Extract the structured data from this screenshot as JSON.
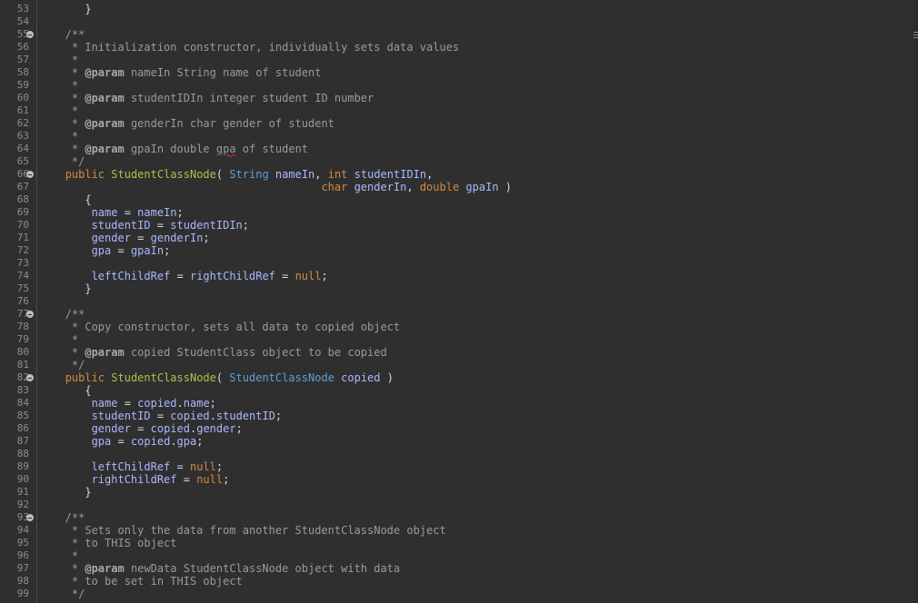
{
  "editor": {
    "language": "java",
    "colors": {
      "background": "#2f2f2f",
      "keyword": "#d38a3e",
      "type": "#5d9fd6",
      "method": "#a7c44a",
      "field": "#aab8ff",
      "comment": "#9a9a9a"
    },
    "fold_lines": [
      55,
      66,
      77,
      82,
      93
    ],
    "lines": [
      {
        "n": "53",
        "t": [
          [
            "p",
            "      }"
          ]
        ]
      },
      {
        "n": "54",
        "t": []
      },
      {
        "n": "55",
        "t": [
          [
            "c",
            "   /**"
          ]
        ]
      },
      {
        "n": "56",
        "t": [
          [
            "c",
            "    * Initialization constructor, individually sets data values"
          ]
        ]
      },
      {
        "n": "57",
        "t": [
          [
            "c",
            "    *"
          ]
        ]
      },
      {
        "n": "58",
        "t": [
          [
            "c",
            "    * "
          ],
          [
            "g",
            "@param"
          ],
          [
            "c",
            " nameIn String name of student"
          ]
        ]
      },
      {
        "n": "59",
        "t": [
          [
            "c",
            "    *"
          ]
        ]
      },
      {
        "n": "60",
        "t": [
          [
            "c",
            "    * "
          ],
          [
            "g",
            "@param"
          ],
          [
            "c",
            " studentIDIn integer student ID number"
          ]
        ]
      },
      {
        "n": "61",
        "t": [
          [
            "c",
            "    *"
          ]
        ]
      },
      {
        "n": "62",
        "t": [
          [
            "c",
            "    * "
          ],
          [
            "g",
            "@param"
          ],
          [
            "c",
            " genderIn char gender of student"
          ]
        ]
      },
      {
        "n": "63",
        "t": [
          [
            "c",
            "    *"
          ]
        ]
      },
      {
        "n": "64",
        "t": [
          [
            "c",
            "    * "
          ],
          [
            "g",
            "@param"
          ],
          [
            "c",
            " gpaIn double "
          ],
          [
            "s",
            "gpa"
          ],
          [
            "c",
            " of student"
          ]
        ]
      },
      {
        "n": "65",
        "t": [
          [
            "c",
            "    */"
          ]
        ]
      },
      {
        "n": "66",
        "t": [
          [
            "p",
            "   "
          ],
          [
            "k",
            "public"
          ],
          [
            "p",
            " "
          ],
          [
            "m",
            "StudentClassNode"
          ],
          [
            "p",
            "( "
          ],
          [
            "y",
            "String"
          ],
          [
            "p",
            " "
          ],
          [
            "v",
            "nameIn"
          ],
          [
            "p",
            ", "
          ],
          [
            "k",
            "int"
          ],
          [
            "p",
            " "
          ],
          [
            "v",
            "studentIDIn"
          ],
          [
            "p",
            ","
          ]
        ]
      },
      {
        "n": "67",
        "t": [
          [
            "p",
            "                                          "
          ],
          [
            "k",
            "char"
          ],
          [
            "p",
            " "
          ],
          [
            "v",
            "genderIn"
          ],
          [
            "p",
            ", "
          ],
          [
            "k",
            "double"
          ],
          [
            "p",
            " "
          ],
          [
            "v",
            "gpaIn"
          ],
          [
            "p",
            " )"
          ]
        ]
      },
      {
        "n": "68",
        "t": [
          [
            "p",
            "      {"
          ]
        ]
      },
      {
        "n": "69",
        "t": [
          [
            "p",
            "       "
          ],
          [
            "v",
            "name"
          ],
          [
            "p",
            " = "
          ],
          [
            "v",
            "nameIn"
          ],
          [
            "p",
            ";"
          ]
        ]
      },
      {
        "n": "70",
        "t": [
          [
            "p",
            "       "
          ],
          [
            "v",
            "studentID"
          ],
          [
            "p",
            " = "
          ],
          [
            "v",
            "studentIDIn"
          ],
          [
            "p",
            ";"
          ]
        ]
      },
      {
        "n": "71",
        "t": [
          [
            "p",
            "       "
          ],
          [
            "v",
            "gender"
          ],
          [
            "p",
            " = "
          ],
          [
            "v",
            "genderIn"
          ],
          [
            "p",
            ";"
          ]
        ]
      },
      {
        "n": "72",
        "t": [
          [
            "p",
            "       "
          ],
          [
            "v",
            "gpa"
          ],
          [
            "p",
            " = "
          ],
          [
            "v",
            "gpaIn"
          ],
          [
            "p",
            ";"
          ]
        ]
      },
      {
        "n": "73",
        "t": []
      },
      {
        "n": "74",
        "t": [
          [
            "p",
            "       "
          ],
          [
            "v",
            "leftChildRef"
          ],
          [
            "p",
            " = "
          ],
          [
            "v",
            "rightChildRef"
          ],
          [
            "p",
            " = "
          ],
          [
            "k",
            "null"
          ],
          [
            "p",
            ";"
          ]
        ]
      },
      {
        "n": "75",
        "t": [
          [
            "p",
            "      }"
          ]
        ]
      },
      {
        "n": "76",
        "t": []
      },
      {
        "n": "77",
        "t": [
          [
            "c",
            "   /**"
          ]
        ]
      },
      {
        "n": "78",
        "t": [
          [
            "c",
            "    * Copy constructor, sets all data to copied object"
          ]
        ]
      },
      {
        "n": "79",
        "t": [
          [
            "c",
            "    *"
          ]
        ]
      },
      {
        "n": "80",
        "t": [
          [
            "c",
            "    * "
          ],
          [
            "g",
            "@param"
          ],
          [
            "c",
            " copied StudentClass object to be copied"
          ]
        ]
      },
      {
        "n": "81",
        "t": [
          [
            "c",
            "    */"
          ]
        ]
      },
      {
        "n": "82",
        "t": [
          [
            "p",
            "   "
          ],
          [
            "k",
            "public"
          ],
          [
            "p",
            " "
          ],
          [
            "m",
            "StudentClassNode"
          ],
          [
            "p",
            "( "
          ],
          [
            "y",
            "StudentClassNode"
          ],
          [
            "p",
            " "
          ],
          [
            "v",
            "copied"
          ],
          [
            "p",
            " )"
          ]
        ]
      },
      {
        "n": "83",
        "t": [
          [
            "p",
            "      {"
          ]
        ]
      },
      {
        "n": "84",
        "t": [
          [
            "p",
            "       "
          ],
          [
            "v",
            "name"
          ],
          [
            "p",
            " = "
          ],
          [
            "v",
            "copied"
          ],
          [
            "p",
            "."
          ],
          [
            "v",
            "name"
          ],
          [
            "p",
            ";"
          ]
        ]
      },
      {
        "n": "85",
        "t": [
          [
            "p",
            "       "
          ],
          [
            "v",
            "studentID"
          ],
          [
            "p",
            " = "
          ],
          [
            "v",
            "copied"
          ],
          [
            "p",
            "."
          ],
          [
            "v",
            "studentID"
          ],
          [
            "p",
            ";"
          ]
        ]
      },
      {
        "n": "86",
        "t": [
          [
            "p",
            "       "
          ],
          [
            "v",
            "gender"
          ],
          [
            "p",
            " = "
          ],
          [
            "v",
            "copied"
          ],
          [
            "p",
            "."
          ],
          [
            "v",
            "gender"
          ],
          [
            "p",
            ";"
          ]
        ]
      },
      {
        "n": "87",
        "t": [
          [
            "p",
            "       "
          ],
          [
            "v",
            "gpa"
          ],
          [
            "p",
            " = "
          ],
          [
            "v",
            "copied"
          ],
          [
            "p",
            "."
          ],
          [
            "v",
            "gpa"
          ],
          [
            "p",
            ";"
          ]
        ]
      },
      {
        "n": "88",
        "t": []
      },
      {
        "n": "89",
        "t": [
          [
            "p",
            "       "
          ],
          [
            "v",
            "leftChildRef"
          ],
          [
            "p",
            " = "
          ],
          [
            "k",
            "null"
          ],
          [
            "p",
            ";"
          ]
        ]
      },
      {
        "n": "90",
        "t": [
          [
            "p",
            "       "
          ],
          [
            "v",
            "rightChildRef"
          ],
          [
            "p",
            " = "
          ],
          [
            "k",
            "null"
          ],
          [
            "p",
            ";"
          ]
        ]
      },
      {
        "n": "91",
        "t": [
          [
            "p",
            "      }"
          ]
        ]
      },
      {
        "n": "92",
        "t": []
      },
      {
        "n": "93",
        "t": [
          [
            "c",
            "   /**"
          ]
        ]
      },
      {
        "n": "94",
        "t": [
          [
            "c",
            "    * Sets only the data from another StudentClassNode object"
          ]
        ]
      },
      {
        "n": "95",
        "t": [
          [
            "c",
            "    * to THIS object"
          ]
        ]
      },
      {
        "n": "96",
        "t": [
          [
            "c",
            "    *"
          ]
        ]
      },
      {
        "n": "97",
        "t": [
          [
            "c",
            "    * "
          ],
          [
            "g",
            "@param"
          ],
          [
            "c",
            " newData StudentClassNode object with data"
          ]
        ]
      },
      {
        "n": "98",
        "t": [
          [
            "c",
            "    * to be set in THIS object"
          ]
        ]
      },
      {
        "n": "99",
        "t": [
          [
            "c",
            "    */"
          ]
        ]
      }
    ]
  }
}
